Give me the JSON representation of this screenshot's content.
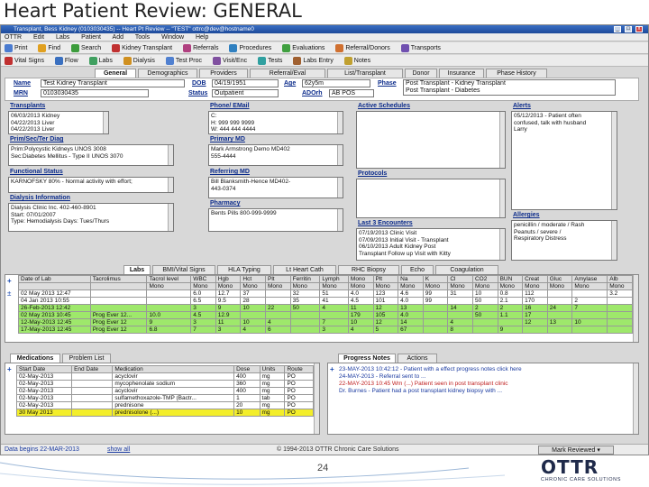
{
  "slide": {
    "title": "Heart Patient Review:  GENERAL",
    "page_number": "24"
  },
  "window": {
    "title": "Transplant, Bess Kidney (0103030435) -- Heart Pt Review -- \"TEST\" ottrc@dev@hostname0"
  },
  "menubar": {
    "items": [
      "OTTR",
      "Edit",
      "Labs",
      "Patient",
      "Add",
      "Tools",
      "Window",
      "Help"
    ]
  },
  "toolbar1": {
    "items": [
      "Print",
      "Find",
      "Search",
      "Kidney Transplant",
      "Referrals",
      "Procedures",
      "Evaluations",
      "Referral/Donors",
      "Transports"
    ]
  },
  "toolbar2": {
    "items": [
      "Vital Signs",
      "Flow",
      "Labs",
      "Dialysis",
      "Test Proc",
      "Visit/Enc",
      "Tests",
      "Labs Entry",
      "Notes"
    ]
  },
  "tabs": [
    "General",
    "Demographics",
    "Providers",
    "Referral/Eval",
    "List/Transplant",
    "Donor",
    "Insurance",
    "Phase History"
  ],
  "patient": {
    "name_label": "Name",
    "name": "Test Kidney Transplant",
    "dob_label": "DOB",
    "dob": "04/19/1951",
    "age_label": "Age",
    "age": "62y5m",
    "phase_label": "Phase",
    "phase": [
      "Post Transplant - Kidney Transplant",
      "Post Transplant - Diabetes"
    ],
    "mrn_label": "MRN",
    "mrn": "0103030435",
    "status_label": "Status",
    "status": "Outpatient",
    "adorh_label": "ADOrh",
    "adorh": "AB POS"
  },
  "panels": {
    "transplants": {
      "title": "Transplants",
      "lines": [
        "06/03/2013 Kidney",
        "04/22/2013 Liver",
        "04/22/2013 Liver"
      ]
    },
    "phone": {
      "title": "Phone/ EMail",
      "lines": [
        "C:",
        "H: 999 999 9999",
        "W: 444 444 4444"
      ]
    },
    "active_schedules": {
      "title": "Active Schedules",
      "lines": []
    },
    "alerts": {
      "title": "Alerts",
      "lines": [
        "05/12/2013 - Patient often",
        "confused, talk with husband",
        "Larry"
      ]
    },
    "prim_sec_diag": {
      "title": "Prim/Sec/Ter Diag",
      "lines": [
        "Prim:Polycystic Kidneys UNOS 3008",
        "Sec:Diabetes Mellitus - Type II UNOS 3070"
      ]
    },
    "primary_md": {
      "title": "Primary MD",
      "lines": [
        "Mark Armstrong Demo MD402",
        "555-4444"
      ]
    },
    "protocols": {
      "title": "Protocols",
      "lines": []
    },
    "allergies": {
      "title": "Allergies",
      "lines": [
        "penicillin / moderate / Rash",
        "Peanuts / severe /",
        "Respiratory Distress"
      ]
    },
    "functional_status": {
      "title": "Functional Status",
      "lines": [
        "KARNOFSKY 80% - Normal activity with effort;"
      ]
    },
    "referring_md": {
      "title": "Referring MD",
      "lines": [
        "Bill Blanksmith-Hence MD402-",
        "443-0374"
      ]
    },
    "last3_encounters": {
      "title": "Last 3 Encounters",
      "lines": [
        "07/19/2013 Clinic Visit",
        "07/09/2013 Initial Visit - Transplant",
        "06/10/2013 Adult Kidney Post",
        "Transplant Follow up Visit with Kitty"
      ]
    },
    "dialysis": {
      "title": "Dialysis Information",
      "lines": [
        "Dialysis Clinic Inc.    402-460-8901",
        "Start: 07/01/2007",
        "Type: Hemodialysis Days: Tues/Thurs"
      ]
    },
    "pharmacy": {
      "title": "Pharmacy",
      "lines": [
        "Bents Pills 800-999-9999"
      ]
    }
  },
  "lab_tabs": [
    "Labs",
    "BMI/Vital Signs",
    "HLA Typing",
    "Lt Heart Cath",
    "RHC Biopsy",
    "Echo",
    "Coagulation"
  ],
  "lab_table": {
    "headers": [
      "Date of Lab",
      "Tacrolimus",
      "Tacrol level",
      "WBC",
      "Hgb",
      "Hct",
      "Plt",
      "Ferritin",
      "Lymph",
      "Mono",
      "Plt",
      "Na",
      "K",
      "Cl",
      "CO2",
      "BUN",
      "Creat",
      "Gluc",
      "Amylase",
      "Alb"
    ],
    "subrow": [
      "",
      "",
      "Mono",
      "Mono",
      "Mono",
      "Mono",
      "Mono",
      "Mono",
      "Mono",
      "Mono",
      "Mono",
      "Mono",
      "Mono",
      "Mono",
      "Mono",
      "Mono",
      "Mono",
      "Mono",
      "Mono",
      "Mono"
    ],
    "rows": [
      {
        "cells": [
          "02 May 2013 12:47",
          "",
          "",
          "6.0",
          "12.7",
          "37",
          "",
          "32",
          "51",
          "4.0",
          "123",
          "4.6",
          "99",
          "31",
          "10",
          "0.8",
          "112",
          "",
          "",
          "3.2"
        ],
        "green": false
      },
      {
        "cells": [
          "04 Jan 2013 10:55",
          "",
          "",
          "6.5",
          "9.5",
          "28",
          "",
          "35",
          "41",
          "4.5",
          "101",
          "4.0",
          "99",
          "",
          "50",
          "2.1",
          "170",
          "",
          "2",
          ""
        ],
        "green": false
      },
      {
        "cells": [
          "26-Feb-2013 12:42",
          "",
          "",
          "3",
          "9",
          "10",
          "22",
          "50",
          "4",
          "11",
          "12",
          "13",
          "",
          "14",
          "2",
          "2",
          "16",
          "24",
          "7",
          ""
        ],
        "green": true
      },
      {
        "cells": [
          "02 May 2013 10:45",
          "Prog Ever 12...",
          "10.0",
          "4.5",
          "12.9",
          "",
          "",
          "",
          "",
          "179",
          "105",
          "4.0",
          "",
          "",
          "50",
          "1.1",
          "17",
          "",
          "",
          ""
        ],
        "green": true
      },
      {
        "cells": [
          "12-May-2013 12:45",
          "Prog Ever 12",
          "9",
          "3",
          "11",
          "10",
          "4",
          "",
          "7",
          "10",
          "12",
          "14",
          "",
          "4",
          "",
          "",
          "12",
          "13",
          "10",
          ""
        ],
        "green": true
      },
      {
        "cells": [
          "17-May-2013 12:45",
          "Prog Ever 12",
          "6.8",
          "7",
          "3",
          "4",
          "6",
          "",
          "3",
          "4",
          "5",
          "67",
          "",
          "8",
          "",
          "9",
          "",
          "",
          "",
          ""
        ],
        "green": true
      }
    ]
  },
  "med_tabs": [
    "Medications",
    "Problem List"
  ],
  "med_table": {
    "headers": [
      "Start Date",
      "End Date",
      "Medication",
      "Dose",
      "Units",
      "Route"
    ],
    "rows": [
      {
        "cells": [
          "02-May-2013",
          "",
          "acyclovir",
          "400",
          "mg",
          "PO"
        ],
        "sel": false
      },
      {
        "cells": [
          "02-May-2013",
          "",
          "mycophenolate sodium",
          "360",
          "mg",
          "PO"
        ],
        "sel": false
      },
      {
        "cells": [
          "02-May-2013",
          "",
          "acyclovir",
          "400",
          "mg",
          "PO"
        ],
        "sel": false
      },
      {
        "cells": [
          "02-May-2013",
          "",
          "sulfamethoxazole-TMP (Bactr...",
          "1",
          "tab",
          "PO"
        ],
        "sel": false
      },
      {
        "cells": [
          "02-May-2013",
          "",
          "prednisone",
          "20",
          "mg",
          "PO"
        ],
        "sel": false
      },
      {
        "cells": [
          "30 May 2013",
          "",
          "prednisolone (...)",
          "10",
          "mg",
          "PO"
        ],
        "sel": true
      }
    ]
  },
  "note_tabs": [
    "Progress Notes",
    "Actions"
  ],
  "notes": {
    "lines": [
      "23-MAY-2013 10:42:12 - Patient with a effect progress notes click here",
      "24-MAY-2013 - Referral sent to ...",
      "22-MAY-2013 10:45 Wm (...) Patient seen in post transplant clinic",
      "Dr. Burnes - Patient had a post transplant kidney biopsy with ..."
    ]
  },
  "footer": {
    "data_begins": "Data begins 22-MAR-2013",
    "show_all": "show all",
    "copyright": "© 1994-2013 OTTR Chronic Care Solutions",
    "mark_reviewed": "Mark Reviewed"
  },
  "logo": {
    "text": "OTTR",
    "tagline": "CHRONIC CARE SOLUTIONS"
  }
}
